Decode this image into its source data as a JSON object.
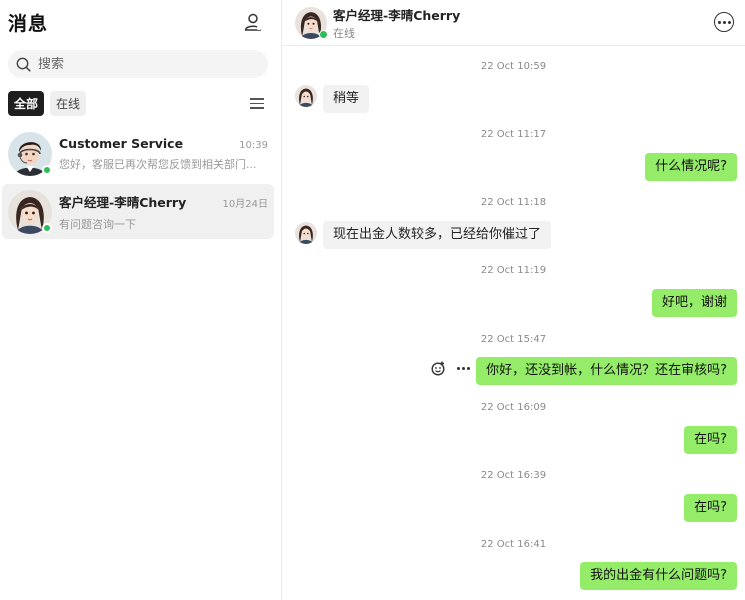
{
  "sidebar": {
    "title": "消息",
    "contacts_icon": "person-outline-icon",
    "search": {
      "placeholder": "搜索",
      "value": ""
    },
    "filters": [
      {
        "label": "全部",
        "active": true
      },
      {
        "label": "在线",
        "active": false
      }
    ],
    "conversations": [
      {
        "name": "Customer Service",
        "time": "10:39",
        "preview": "您好，客服已再次帮您反馈到相关部门...",
        "online": true,
        "selected": false
      },
      {
        "name": "客户经理-李晴Cherry",
        "time": "10月24日",
        "preview": "有问题咨询一下",
        "online": true,
        "selected": true
      }
    ]
  },
  "chat": {
    "name": "客户经理-李晴Cherry",
    "status": "在线",
    "timestamps": [
      "22 Oct 10:59",
      "22 Oct 11:17",
      "22 Oct 11:18",
      "22 Oct 11:19",
      "22 Oct 15:47",
      "22 Oct 16:09",
      "22 Oct 16:39",
      "22 Oct 16:41"
    ],
    "messages": [
      {
        "text": "稍等",
        "direction": "in"
      },
      {
        "text": "什么情况呢?",
        "direction": "out"
      },
      {
        "text": "现在出金人数较多，已经给你催过了",
        "direction": "in"
      },
      {
        "text": "好吧，谢谢",
        "direction": "out"
      },
      {
        "text": "你好，还没到帐，什么情况？还在审核吗?",
        "direction": "out"
      },
      {
        "text": "在吗?",
        "direction": "out"
      },
      {
        "text": "在吗?",
        "direction": "out"
      },
      {
        "text": "我的出金有什么问题吗?",
        "direction": "out"
      }
    ]
  },
  "colors": {
    "outgoing_bubble": "#95ec69",
    "incoming_bubble": "#f2f2f2",
    "online": "#2ebd59"
  }
}
